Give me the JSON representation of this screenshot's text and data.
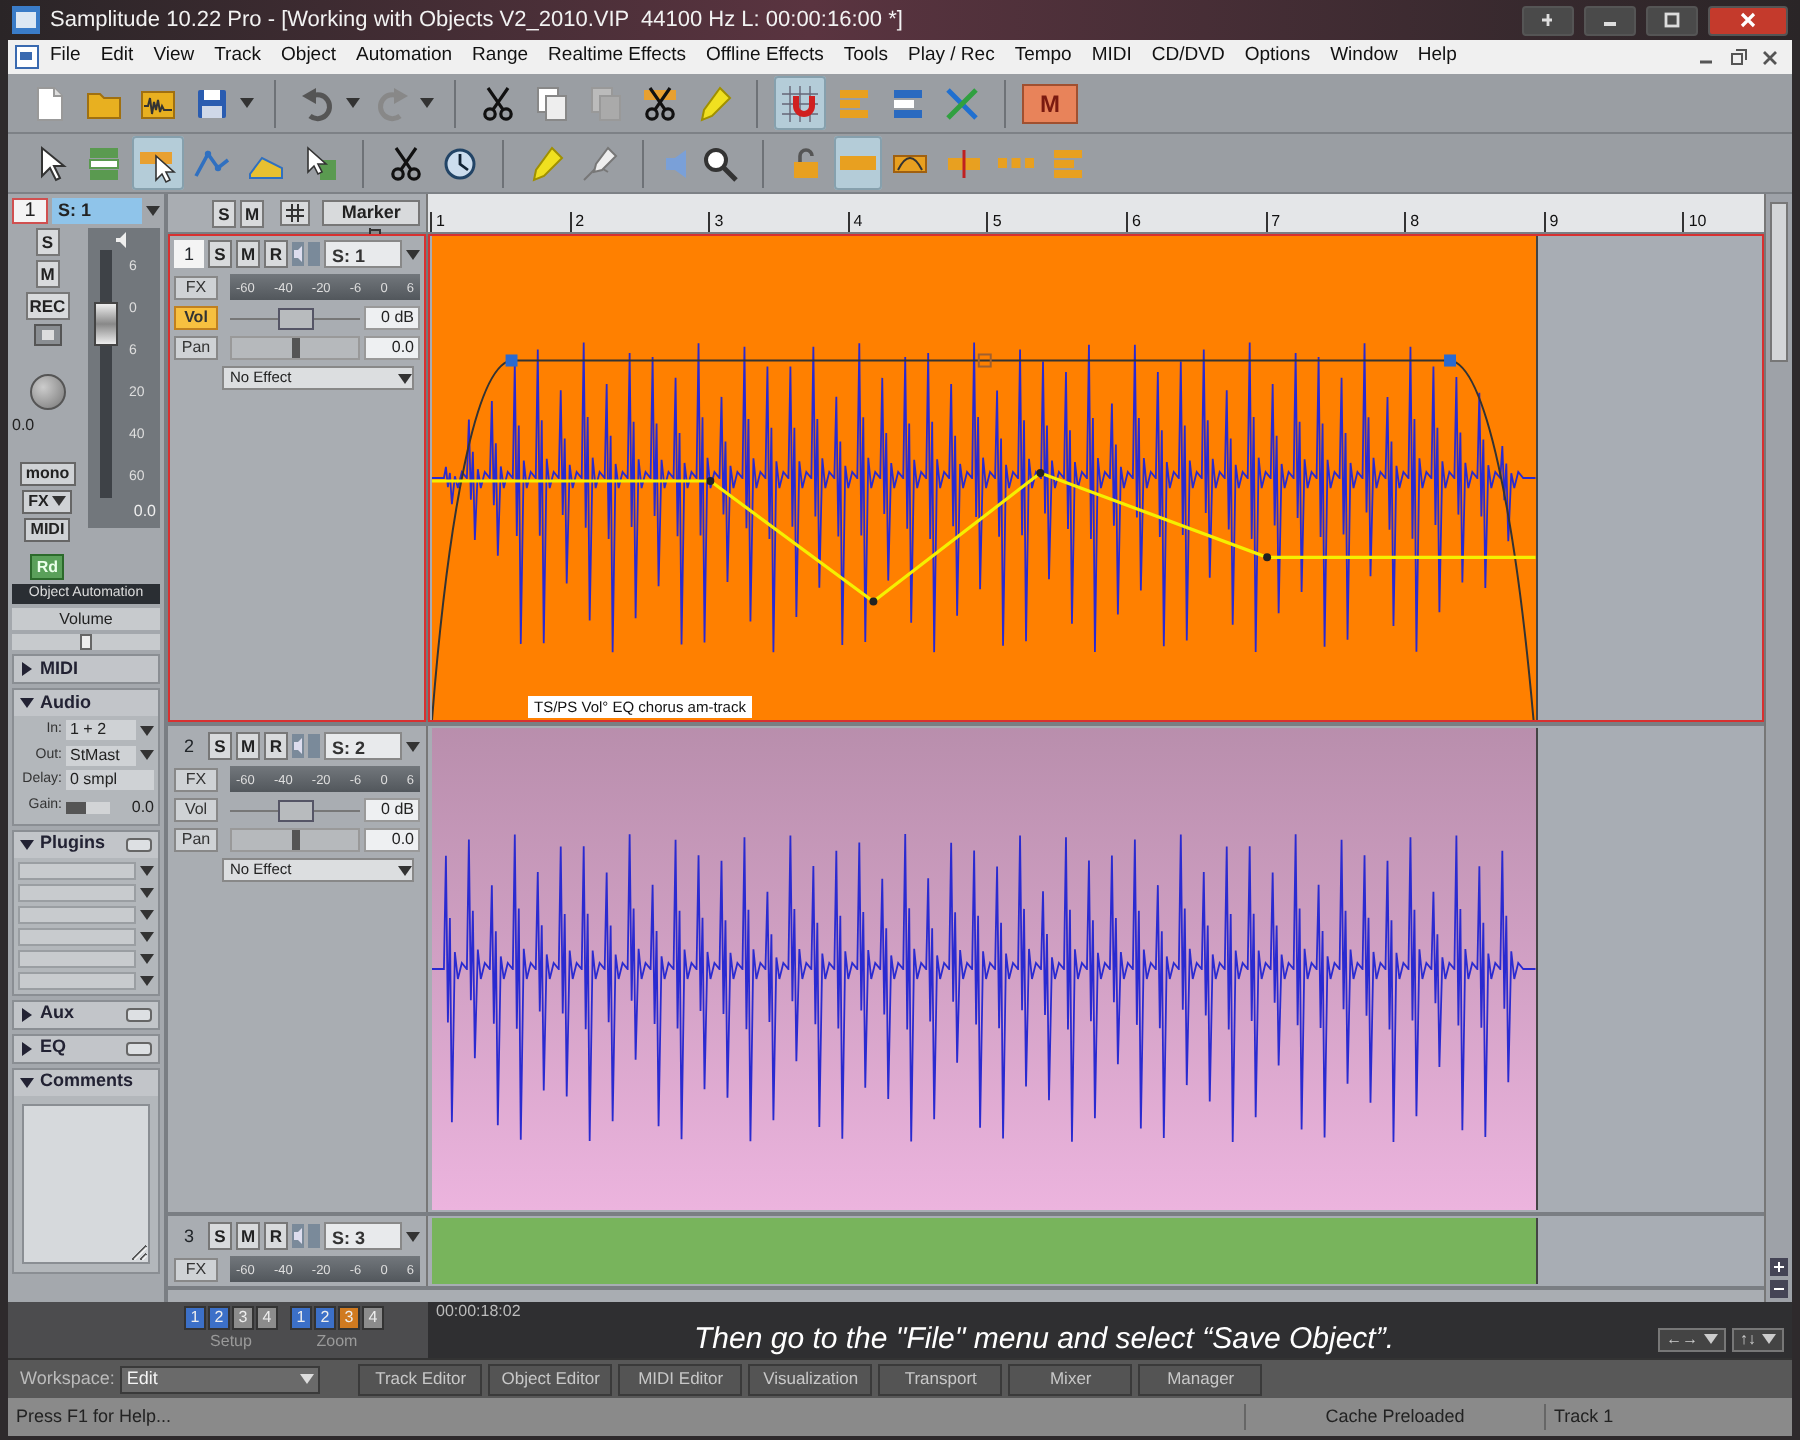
{
  "window": {
    "title": "Samplitude 10.22 Pro - [Working with Objects V2_2010.VIP  44100 Hz L: 00:00:16:00 *]"
  },
  "menu": [
    "File",
    "Edit",
    "View",
    "Track",
    "Object",
    "Automation",
    "Range",
    "Realtime Effects",
    "Offline Effects",
    "Tools",
    "Play / Rec",
    "Tempo",
    "MIDI",
    "CD/DVD",
    "Options",
    "Window",
    "Help"
  ],
  "toolbar_1": [
    {
      "selected": false
    },
    {
      "selected": false
    },
    {
      "selected": false
    },
    {
      "selected": false
    },
    {
      "selected": false
    },
    {
      "selected": false
    },
    {
      "selected": false
    },
    {
      "selected": false
    },
    {
      "selected": false
    },
    {
      "selected": false
    },
    {
      "selected": false
    },
    {
      "selected": true
    },
    {
      "selected": false
    },
    {
      "selected": false
    },
    {
      "selected": false
    },
    {
      "label": "M",
      "selected": false
    }
  ],
  "toolbar_2": [
    {
      "selected": false
    },
    {
      "selected": false
    },
    {
      "selected": true
    },
    {
      "selected": false
    },
    {
      "selected": false
    },
    {
      "selected": false
    },
    {
      "selected": false
    },
    {
      "selected": false
    },
    {
      "selected": false
    },
    {
      "selected": false
    },
    {
      "selected": false
    },
    {
      "selected": false
    },
    {
      "selected": false
    },
    {
      "selected": true
    },
    {
      "selected": false
    },
    {
      "selected": false
    },
    {
      "selected": false
    },
    {
      "selected": false
    }
  ],
  "inspector": {
    "track_number": "1",
    "track_name": "S: 1",
    "buttons": [
      "S",
      "M",
      "REC"
    ],
    "fader": {
      "scale": [
        "6",
        "0",
        "6",
        "20",
        "40",
        "60"
      ],
      "level": 0.75,
      "reading": "0.0"
    },
    "pan_reading": "0.0",
    "options": [
      {
        "label": "mono",
        "dropdown": false
      },
      {
        "label": "FX",
        "dropdown": true
      },
      {
        "label": "MIDI",
        "dropdown": false
      }
    ],
    "read_button": "Rd",
    "automation": {
      "title": "Object Automation",
      "parameter": "Volume",
      "level": 0.5
    },
    "sections": [
      {
        "title": "MIDI",
        "expanded": false,
        "toggle": false
      },
      {
        "title": "Audio",
        "kind": "fields",
        "expanded": true,
        "toggle": false,
        "fields": [
          {
            "kind": "select",
            "label": "In:",
            "value": "1 + 2"
          },
          {
            "kind": "select",
            "label": "Out:",
            "value": "StMast"
          },
          {
            "kind": "text",
            "label": "Delay:",
            "value": "0 smpl"
          },
          {
            "kind": "meter",
            "label": "Gain:",
            "level": 0.45,
            "value": "0.0"
          }
        ]
      },
      {
        "title": "Plugins",
        "kind": "slots",
        "expanded": true,
        "toggle": true,
        "slots": [
          {
            "kind": "empty"
          },
          {
            "kind": "empty"
          },
          {
            "kind": "empty"
          },
          {
            "kind": "empty"
          },
          {
            "kind": "empty"
          },
          {
            "kind": "empty"
          }
        ]
      },
      {
        "title": "Aux",
        "expanded": false,
        "toggle": true
      },
      {
        "title": "EQ",
        "expanded": false,
        "toggle": true
      },
      {
        "title": "Comments",
        "kind": "notes",
        "expanded": true,
        "toggle": false
      }
    ]
  },
  "track_toolbar": {
    "buttons": [
      "S",
      "M"
    ],
    "marker": "Marker"
  },
  "ruler": {
    "marks": [
      "1",
      "2",
      "3",
      "4",
      "5",
      "6",
      "7",
      "8",
      "9",
      "10"
    ]
  },
  "tracks": [
    {
      "kind": "full",
      "number": "1",
      "name": "S: 1",
      "selected": true,
      "buttons": [
        "S",
        "M",
        "R"
      ],
      "fx": "FX",
      "meter_scale": [
        "-60",
        "-40",
        "-20",
        "-6",
        "0",
        "6"
      ],
      "vol": {
        "label": "Vol",
        "active": true,
        "level": 0.5,
        "reading": "0 dB"
      },
      "pan": {
        "label": "Pan",
        "level": 0.5,
        "reading": "0.0"
      },
      "effect": "No Effect",
      "object": {
        "color": "#ff8000",
        "gradient": false,
        "waveform": true,
        "automation": true,
        "label": "TS/PS Vol° EQ chorus am-track"
      }
    },
    {
      "kind": "full",
      "number": "2",
      "name": "S: 2",
      "selected": false,
      "buttons": [
        "S",
        "M",
        "R"
      ],
      "fx": "FX",
      "meter_scale": [
        "-60",
        "-40",
        "-20",
        "-6",
        "0",
        "6"
      ],
      "vol": {
        "label": "Vol",
        "active": false,
        "level": 0.5,
        "reading": "0 dB"
      },
      "pan": {
        "label": "Pan",
        "level": 0.5,
        "reading": "0.0"
      },
      "effect": "No Effect",
      "object": {
        "color": "#ecb4de",
        "gradient": true,
        "waveform": true,
        "automation": false
      }
    },
    {
      "kind": "compact",
      "number": "3",
      "name": "S: 3",
      "selected": false,
      "buttons": [
        "S",
        "M",
        "R"
      ],
      "fx": "FX",
      "meter_scale": [
        "-60",
        "-40",
        "-20",
        "-6",
        "0",
        "6"
      ],
      "object": {
        "color": "#78b45c",
        "gradient": false,
        "waveform": false,
        "automation": false
      }
    }
  ],
  "transport": {
    "setup": {
      "label": "Setup",
      "buttons": [
        {
          "label": "1",
          "color": "#3c70c8"
        },
        {
          "label": "2",
          "color": "#3c70c8"
        },
        {
          "label": "3",
          "color": "#8c8c8c"
        },
        {
          "label": "4",
          "color": "#8c8c8c"
        }
      ]
    },
    "zoom": {
      "label": "Zoom",
      "buttons": [
        {
          "label": "1",
          "color": "#3c70c8"
        },
        {
          "label": "2",
          "color": "#3c70c8"
        },
        {
          "label": "3",
          "color": "#d07a20"
        },
        {
          "label": "4",
          "color": "#8c8c8c"
        }
      ]
    },
    "time": "00:00:18:02",
    "caption": "Then go to the \"File\" menu and select “Save Object”.",
    "nav": [
      "←→",
      "↑↓"
    ]
  },
  "workspace": {
    "label": "Workspace:",
    "value": "Edit",
    "tabs": [
      "Track Editor",
      "Object Editor",
      "MIDI Editor",
      "Visualization",
      "Transport",
      "Mixer",
      "Manager"
    ]
  },
  "status_bar": {
    "help": "Press F1 for Help...",
    "cache": "Cache Preloaded",
    "track": "Track 1"
  }
}
